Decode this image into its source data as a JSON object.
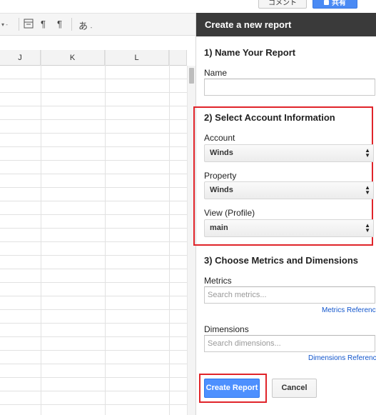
{
  "topbar": {
    "comment_label": "コメント",
    "share_label": "共有"
  },
  "toolbar": {
    "icons": [
      "caret-down-icon",
      "wrap-icon",
      "ltr-icon",
      "rtl-icon",
      "input-tools-icon"
    ],
    "input_label": "あ"
  },
  "grid": {
    "columns": [
      "J",
      "K",
      "L"
    ]
  },
  "sidebar": {
    "title": "Create a new report",
    "section1": {
      "title": "1) Name Your Report",
      "name_label": "Name",
      "name_value": ""
    },
    "section2": {
      "title": "2) Select Account Information",
      "account_label": "Account",
      "account_value": "Winds",
      "property_label": "Property",
      "property_value": "Winds",
      "view_label": "View (Profile)",
      "view_value": "main"
    },
    "section3": {
      "title": "3) Choose Metrics and Dimensions",
      "metrics_label": "Metrics",
      "metrics_placeholder": "Search metrics...",
      "metrics_link": "Metrics Reference",
      "dimensions_label": "Dimensions",
      "dimensions_placeholder": "Search dimensions...",
      "dimensions_link": "Dimensions Reference"
    },
    "buttons": {
      "create": "Create Report",
      "cancel": "Cancel"
    }
  },
  "colors": {
    "header_bg": "#3a3a3a",
    "primary_button": "#4d90fe",
    "highlight_box": "#e0242a",
    "link": "#1155cc"
  }
}
